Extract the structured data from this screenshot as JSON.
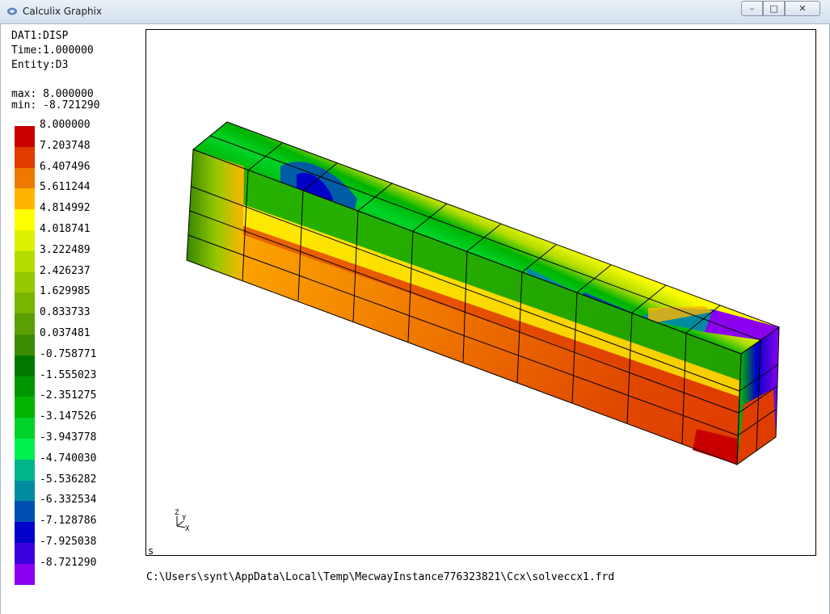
{
  "window": {
    "title": "Calculix Graphix",
    "minimize_symbol": "–",
    "maximize_symbol": "□",
    "close_symbol": "✕"
  },
  "info": {
    "dataset": "DAT1:DISP",
    "time": "Time:1.000000",
    "entity": "Entity:D3",
    "max": "max: 8.000000",
    "min": "min: -8.721290"
  },
  "legend": {
    "entries": [
      {
        "label": "8.000000",
        "color": "#c80000"
      },
      {
        "label": "7.203748",
        "color": "#e03c00"
      },
      {
        "label": "6.407496",
        "color": "#f07800"
      },
      {
        "label": "5.611244",
        "color": "#ffb400"
      },
      {
        "label": "4.814992",
        "color": "#ffff00"
      },
      {
        "label": "4.018741",
        "color": "#dcf000"
      },
      {
        "label": "3.222489",
        "color": "#b4dc00"
      },
      {
        "label": "2.426237",
        "color": "#96c800"
      },
      {
        "label": "1.629985",
        "color": "#78b400"
      },
      {
        "label": "0.833733",
        "color": "#5aa000"
      },
      {
        "label": "0.037481",
        "color": "#3c8c00"
      },
      {
        "label": "-0.758771",
        "color": "#007800"
      },
      {
        "label": "-1.555023",
        "color": "#009600"
      },
      {
        "label": "-2.351275",
        "color": "#00b400"
      },
      {
        "label": "-3.147526",
        "color": "#00d228"
      },
      {
        "label": "-3.943778",
        "color": "#00f050"
      },
      {
        "label": "-4.740030",
        "color": "#00b48c"
      },
      {
        "label": "-5.536282",
        "color": "#008ca0"
      },
      {
        "label": "-6.332534",
        "color": "#0050b4"
      },
      {
        "label": "-7.128786",
        "color": "#0000c8"
      },
      {
        "label": "-7.925038",
        "color": "#3c00dc"
      },
      {
        "label": "-8.721290",
        "color": "#8c00f0"
      }
    ]
  },
  "viewport": {
    "view_mode": "s",
    "axes": {
      "z": "Z",
      "y": "Y",
      "x": "X"
    }
  },
  "file_path": "C:\\Users\\synt\\AppData\\Local\\Temp\\MecwayInstance776323821\\Ccx\\solveccx1.frd"
}
